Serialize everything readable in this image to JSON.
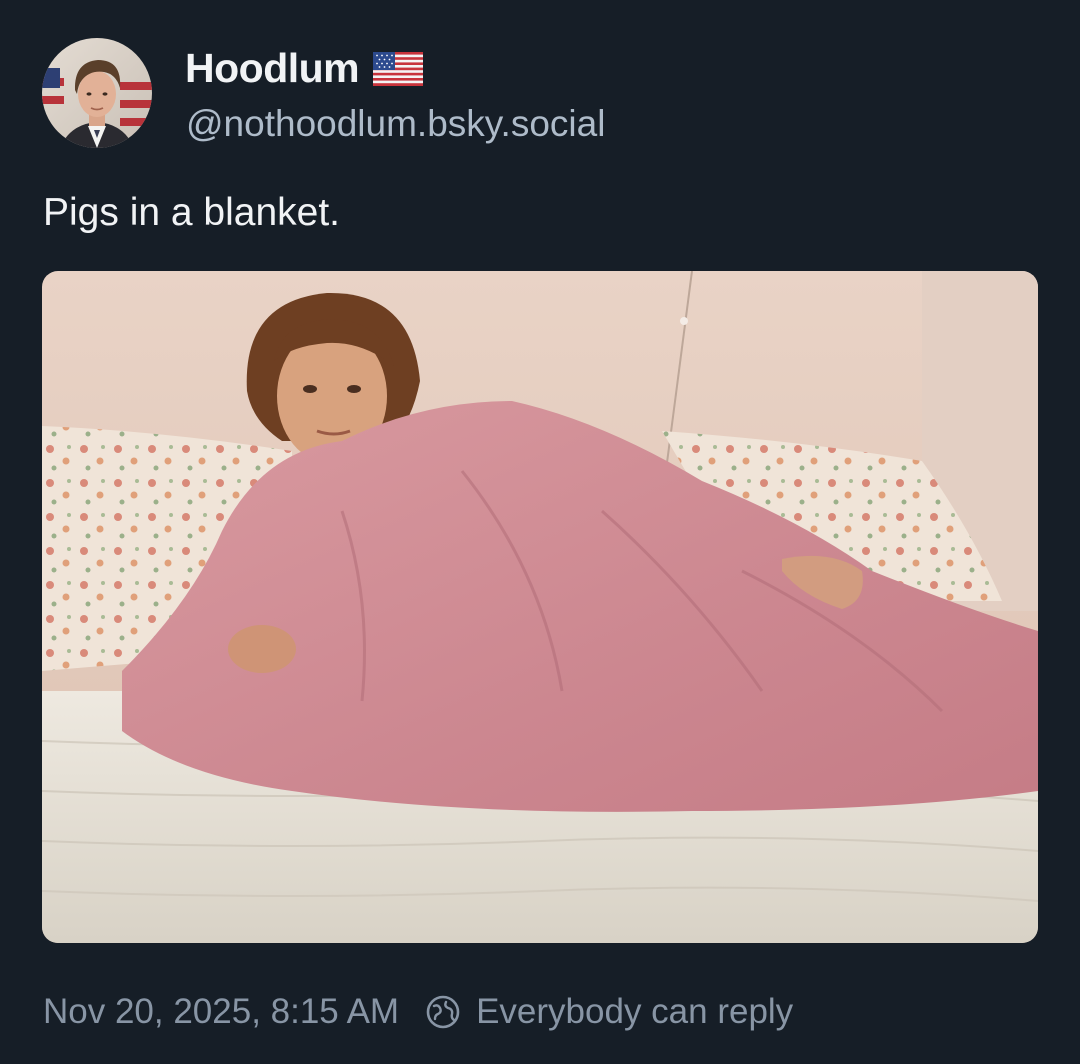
{
  "author": {
    "display_name": "Hoodlum",
    "handle": "@nothoodlum.bsky.social",
    "badge_icon": "us-flag-icon",
    "avatar_icon": "avatar"
  },
  "post": {
    "text": "Pigs in a blanket.",
    "image": "photo-man-in-pink-blanket-on-bed"
  },
  "meta": {
    "timestamp": "Nov 20, 2025, 8:15 AM",
    "reply_setting": "Everybody can reply",
    "reply_icon": "globe-icon"
  },
  "colors": {
    "background": "#161e27",
    "primary_text": "#f1f3f5",
    "handle_text": "#aebbc9",
    "meta_text": "#8895a5"
  }
}
